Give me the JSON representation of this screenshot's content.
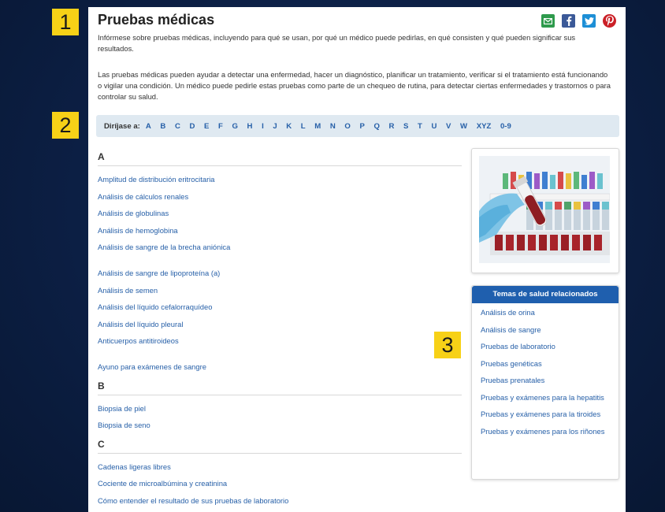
{
  "badges": [
    "1",
    "2",
    "3"
  ],
  "header": {
    "title": "Pruebas médicas"
  },
  "share": {
    "email_icon": "email-icon",
    "facebook_icon": "facebook-icon",
    "twitter_icon": "twitter-icon",
    "pinterest_icon": "pinterest-icon"
  },
  "intro": {
    "p1": "Infórmese sobre pruebas médicas, incluyendo para qué se usan, por qué un médico puede pedirlas, en qué consisten y qué pueden significar sus resultados.",
    "p2": "Las pruebas médicas pueden ayudar a detectar una enfermedad, hacer un diagnóstico, planificar un tratamiento, verificar si el tratamiento está funcionando o vigilar una condición. Un médico puede pedirle estas pruebas como parte de un chequeo de rutina, para detectar ciertas enfermedades y trastornos o para controlar su salud."
  },
  "alphabet": {
    "label": "Diríjase a:",
    "letters": [
      "A",
      "B",
      "C",
      "D",
      "E",
      "F",
      "G",
      "H",
      "I",
      "J",
      "K",
      "L",
      "M",
      "N",
      "O",
      "P",
      "Q",
      "R",
      "S",
      "T",
      "U",
      "V",
      "W",
      "XYZ",
      "0-9"
    ]
  },
  "sections": [
    {
      "letter": "A",
      "items": [
        "Amplitud de distribución eritrocitaria",
        "Análisis de cálculos renales",
        "Análisis de globulinas",
        "Análisis de hemoglobina",
        "Análisis de sangre de la brecha aniónica",
        "Análisis de sangre de lipoproteína (a)",
        "Análisis de semen",
        "Análisis del líquido cefalorraquídeo",
        "Análisis del líquido pleural",
        "Anticuerpos antitiroideos",
        "Ayuno para exámenes de sangre"
      ]
    },
    {
      "letter": "B",
      "items": [
        "Biopsia de piel",
        "Biopsia de seno"
      ]
    },
    {
      "letter": "C",
      "items": [
        "Cadenas ligeras libres",
        "Cociente de microalbúmina y creatinina",
        "Cómo entender el resultado de sus pruebas de laboratorio"
      ]
    }
  ],
  "related": {
    "title": "Temas de salud relacionados",
    "items": [
      "Análisis de orina",
      "Análisis de sangre",
      "Pruebas de laboratorio",
      "Pruebas genéticas",
      "Pruebas prenatales",
      "Pruebas y exámenes para la hepatitis",
      "Pruebas y exámenes para la tiroides",
      "Pruebas y exámenes para los riñones"
    ]
  },
  "colors": {
    "link": "#2760a8",
    "accent": "#1f5fae",
    "badge": "#f7d117",
    "alpha_bg": "#dfe9f1"
  }
}
